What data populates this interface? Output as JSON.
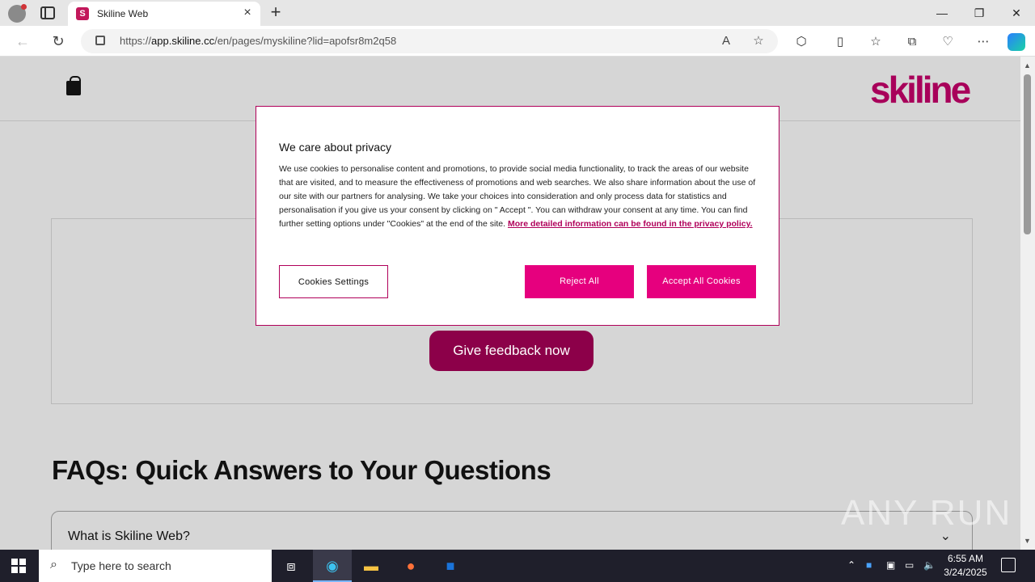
{
  "browser": {
    "tab_title": "Skiline Web",
    "tab_favicon": "S",
    "url_prefix": "https://",
    "url_host": "app.skiline.cc",
    "url_path": "/en/pages/myskiline?lid=apofsr8m2q58"
  },
  "site": {
    "logo": "skiline",
    "brand_color": "#a8005a",
    "feedback_button": "Give feedback now",
    "faq_title": "FAQs: Quick Answers to Your Questions",
    "faq_items": [
      {
        "question": "What is Skiline Web?"
      }
    ]
  },
  "cookie_modal": {
    "title": "We care about privacy",
    "body": "We use cookies to personalise content and promotions, to provide social media functionality, to track the areas of our website that are visited, and to measure the effectiveness of promotions and web searches. We also share information about the use of our site with our partners for analysing. We take your choices into consideration and only process data for statistics and personalisation if you give us your consent by clicking on \" Accept \". You can withdraw your consent at any time. You can find further setting options under \"Cookies\" at the end of the site.",
    "link_text": "More detailed information can be found in the privacy policy.",
    "settings_button": "Cookies Settings",
    "reject_button": "Reject All",
    "accept_button": "Accept All Cookies",
    "accent_color": "#e6007e"
  },
  "watermark": "ANY RUN",
  "taskbar": {
    "search_placeholder": "Type here to search",
    "time": "6:55 AM",
    "date": "3/24/2025"
  }
}
